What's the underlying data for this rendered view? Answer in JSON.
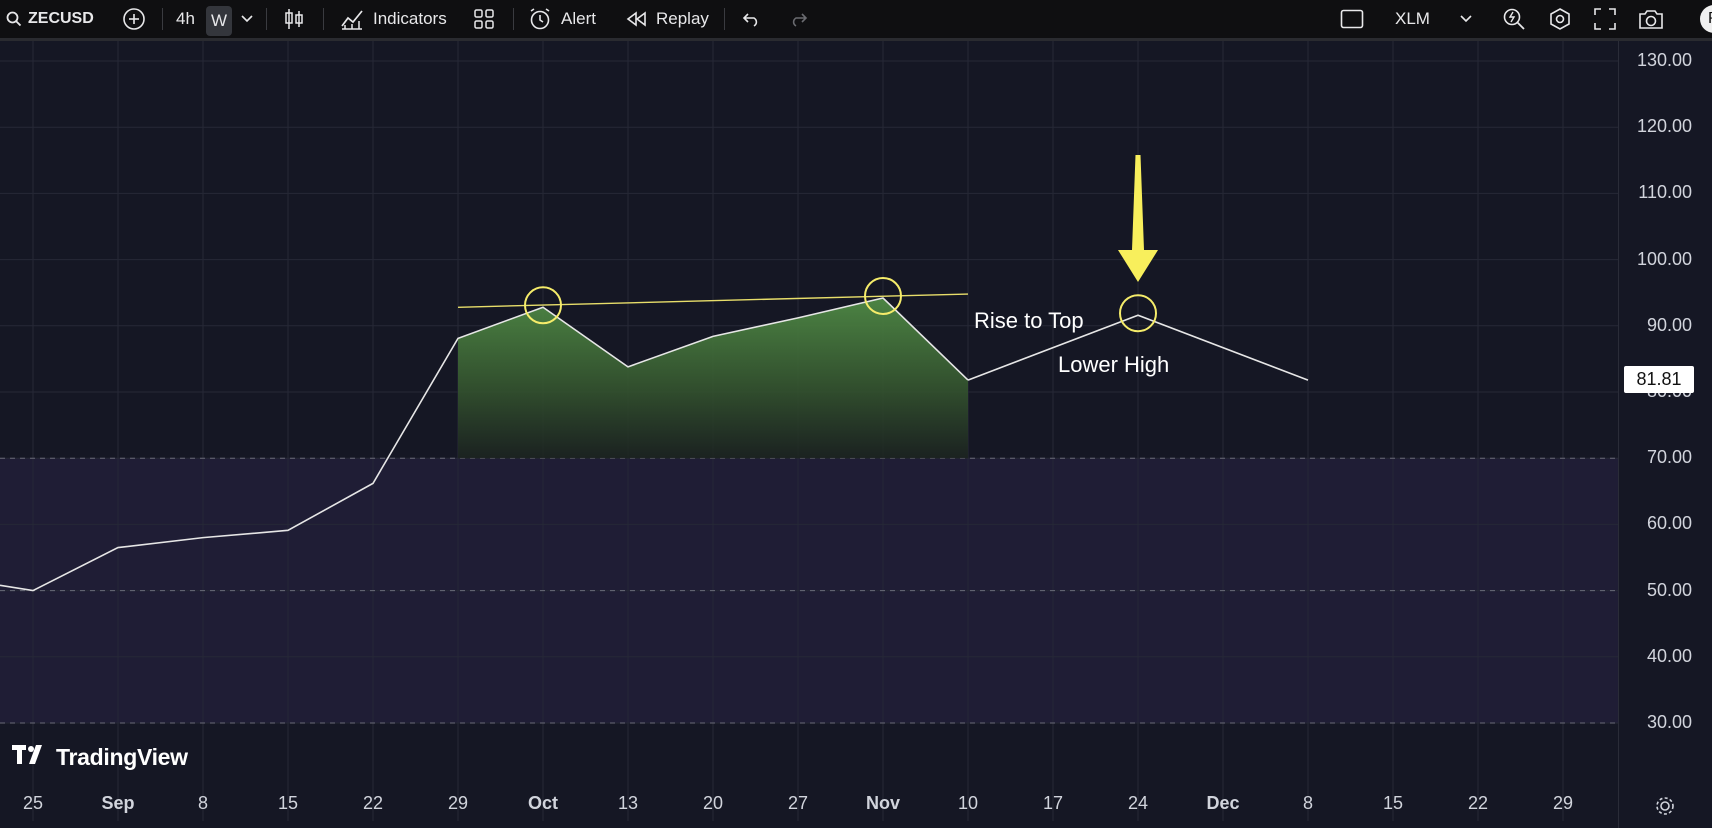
{
  "toolbar": {
    "symbol": "ZECUSD",
    "interval": "4h",
    "active_interval": "W",
    "indicators_label": "Indicators",
    "alert_label": "Alert",
    "replay_label": "Replay",
    "compare_symbol": "XLM",
    "publish_label": "Pu"
  },
  "price_axis": {
    "labels": [
      "130.00",
      "120.00",
      "110.00",
      "100.00",
      "90.00",
      "80.00",
      "70.00",
      "60.00",
      "50.00",
      "40.00",
      "30.00"
    ],
    "current_price": "81.81"
  },
  "time_axis": {
    "labels": [
      {
        "text": "25",
        "bold": false
      },
      {
        "text": "Sep",
        "bold": true
      },
      {
        "text": "8",
        "bold": false
      },
      {
        "text": "15",
        "bold": false
      },
      {
        "text": "22",
        "bold": false
      },
      {
        "text": "29",
        "bold": false
      },
      {
        "text": "Oct",
        "bold": true
      },
      {
        "text": "13",
        "bold": false
      },
      {
        "text": "20",
        "bold": false
      },
      {
        "text": "27",
        "bold": false
      },
      {
        "text": "Nov",
        "bold": true
      },
      {
        "text": "10",
        "bold": false
      },
      {
        "text": "17",
        "bold": false
      },
      {
        "text": "24",
        "bold": false
      },
      {
        "text": "Dec",
        "bold": true
      },
      {
        "text": "8",
        "bold": false
      },
      {
        "text": "15",
        "bold": false
      },
      {
        "text": "22",
        "bold": false
      },
      {
        "text": "29",
        "bold": false
      }
    ]
  },
  "chart_data": {
    "type": "line",
    "y_range": [
      20,
      133
    ],
    "series": [
      {
        "values": [
          50.8,
          50.0,
          56.5,
          58.0,
          59.1,
          66.2,
          88.1,
          92.8,
          83.8,
          88.4,
          91.2,
          94.2,
          81.8
        ]
      }
    ],
    "projection": [
      81.8,
      91.6,
      81.8
    ],
    "resistance_line": [
      92.8,
      94.8
    ],
    "shaded_band": [
      30,
      70
    ],
    "dashed_levels": [
      70,
      50,
      30
    ],
    "highlighted_points": [
      "Oct",
      "Nov",
      "24"
    ]
  },
  "annotations": {
    "rise_to_top": "Rise to Top",
    "lower_high": "Lower High"
  },
  "colors": {
    "background": "#151724",
    "band": "#1f1d35",
    "area_fill": "#4f8a45",
    "highlight": "#f5ec6a",
    "arrow": "#f8ef5c",
    "line": "#e6e6e6"
  },
  "watermark": "TradingView"
}
